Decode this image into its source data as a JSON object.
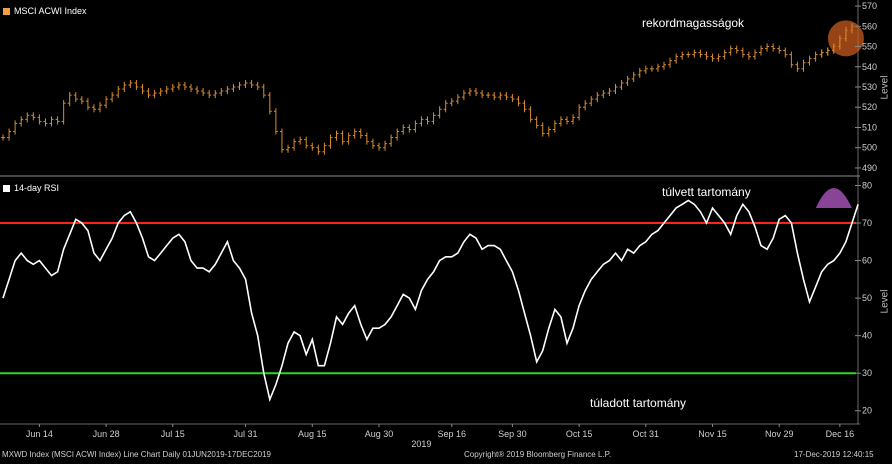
{
  "header": {
    "top_legend": "MSCI ACWI Index",
    "bottom_legend": "14-day RSI",
    "top_color": "#f0a040",
    "bottom_color": "#ffffff"
  },
  "annotations": {
    "record": "rekordmagasságok",
    "overbought": "túlvett tartomány",
    "oversold": "túladott tartomány"
  },
  "footer": {
    "left": "MXWD Index (MSCI ACWI Index) Line Chart  Daily 01JUN2019-17DEC2019",
    "center": "Copyright® 2019 Bloomberg Finance L.P.",
    "right": "17-Dec-2019 12:40:15"
  },
  "colors": {
    "bar": "#d98c30",
    "rsi": "#ffffff",
    "overbought_line": "#ff2020",
    "oversold_line": "#22dd22",
    "circle_fill": "#c85a1e",
    "dome_fill": "#a050b0",
    "grid": "#3a3a3a"
  },
  "chart_data": [
    {
      "type": "bar",
      "title": "MSCI ACWI Index",
      "ylabel": "Level",
      "ylim": [
        488,
        572
      ],
      "yticks": [
        490,
        500,
        510,
        520,
        530,
        540,
        550,
        560,
        570
      ],
      "xtick_labels": [
        "Jun 14",
        "Jun 28",
        "Jul 15",
        "Jul 31",
        "Aug 15",
        "Aug 30",
        "Sep 16",
        "Sep 30",
        "Oct 15",
        "Oct 31",
        "Nov 15",
        "Nov 29",
        "Dec 16"
      ],
      "year_label": "2019",
      "values": [
        505,
        508,
        512,
        514,
        516,
        515,
        513,
        512,
        514,
        513,
        522,
        526,
        524,
        523,
        520,
        519,
        521,
        524,
        526,
        529,
        531,
        532,
        530,
        528,
        526,
        527,
        528,
        529,
        530,
        531,
        530,
        529,
        528,
        527,
        526,
        527,
        528,
        529,
        530,
        531,
        532,
        531,
        530,
        526,
        518,
        508,
        499,
        500,
        503,
        504,
        501,
        500,
        498,
        501,
        505,
        507,
        503,
        506,
        508,
        506,
        503,
        501,
        500,
        502,
        505,
        508,
        510,
        509,
        512,
        514,
        513,
        516,
        519,
        522,
        523,
        525,
        527,
        528,
        527,
        526,
        526,
        525,
        526,
        525,
        524,
        522,
        519,
        514,
        511,
        507,
        509,
        512,
        514,
        513,
        515,
        520,
        522,
        524,
        526,
        527,
        528,
        530,
        532,
        534,
        536,
        538,
        539,
        539,
        540,
        541,
        543,
        545,
        546,
        546,
        547,
        546,
        545,
        544,
        545,
        547,
        549,
        548,
        546,
        545,
        547,
        549,
        550,
        549,
        548,
        546,
        541,
        539,
        542,
        544,
        546,
        547,
        548,
        550,
        554,
        558,
        560
      ]
    },
    {
      "type": "line",
      "title": "14-day RSI",
      "ylabel": "Level",
      "ylim": [
        17,
        82
      ],
      "yticks": [
        20,
        30,
        40,
        50,
        60,
        70,
        80
      ],
      "overbought": 70,
      "oversold": 30,
      "values": [
        50,
        55,
        60,
        62,
        60,
        59,
        60,
        58,
        56,
        57,
        63,
        67,
        71,
        70,
        68,
        62,
        60,
        63,
        66,
        70,
        72,
        73,
        70,
        66,
        61,
        60,
        62,
        64,
        66,
        67,
        65,
        60,
        58,
        58,
        57,
        59,
        62,
        65,
        60,
        58,
        55,
        46,
        40,
        30,
        23,
        27,
        32,
        38,
        41,
        40,
        35,
        39,
        32,
        32,
        38,
        45,
        43,
        46,
        48,
        43,
        39,
        42,
        42,
        43,
        45,
        48,
        51,
        50,
        47,
        52,
        55,
        57,
        60,
        61,
        61,
        62,
        65,
        67,
        66,
        63,
        64,
        64,
        63,
        60,
        57,
        52,
        46,
        40,
        33,
        36,
        42,
        47,
        45,
        38,
        42,
        48,
        52,
        55,
        57,
        59,
        60,
        62,
        60,
        63,
        62,
        64,
        65,
        67,
        68,
        70,
        72,
        74,
        75,
        76,
        75,
        73,
        70,
        74,
        72,
        70,
        67,
        72,
        75,
        73,
        69,
        64,
        63,
        66,
        71,
        72,
        70,
        62,
        55,
        49,
        53,
        57,
        59,
        60,
        62,
        65,
        70,
        75
      ]
    }
  ]
}
